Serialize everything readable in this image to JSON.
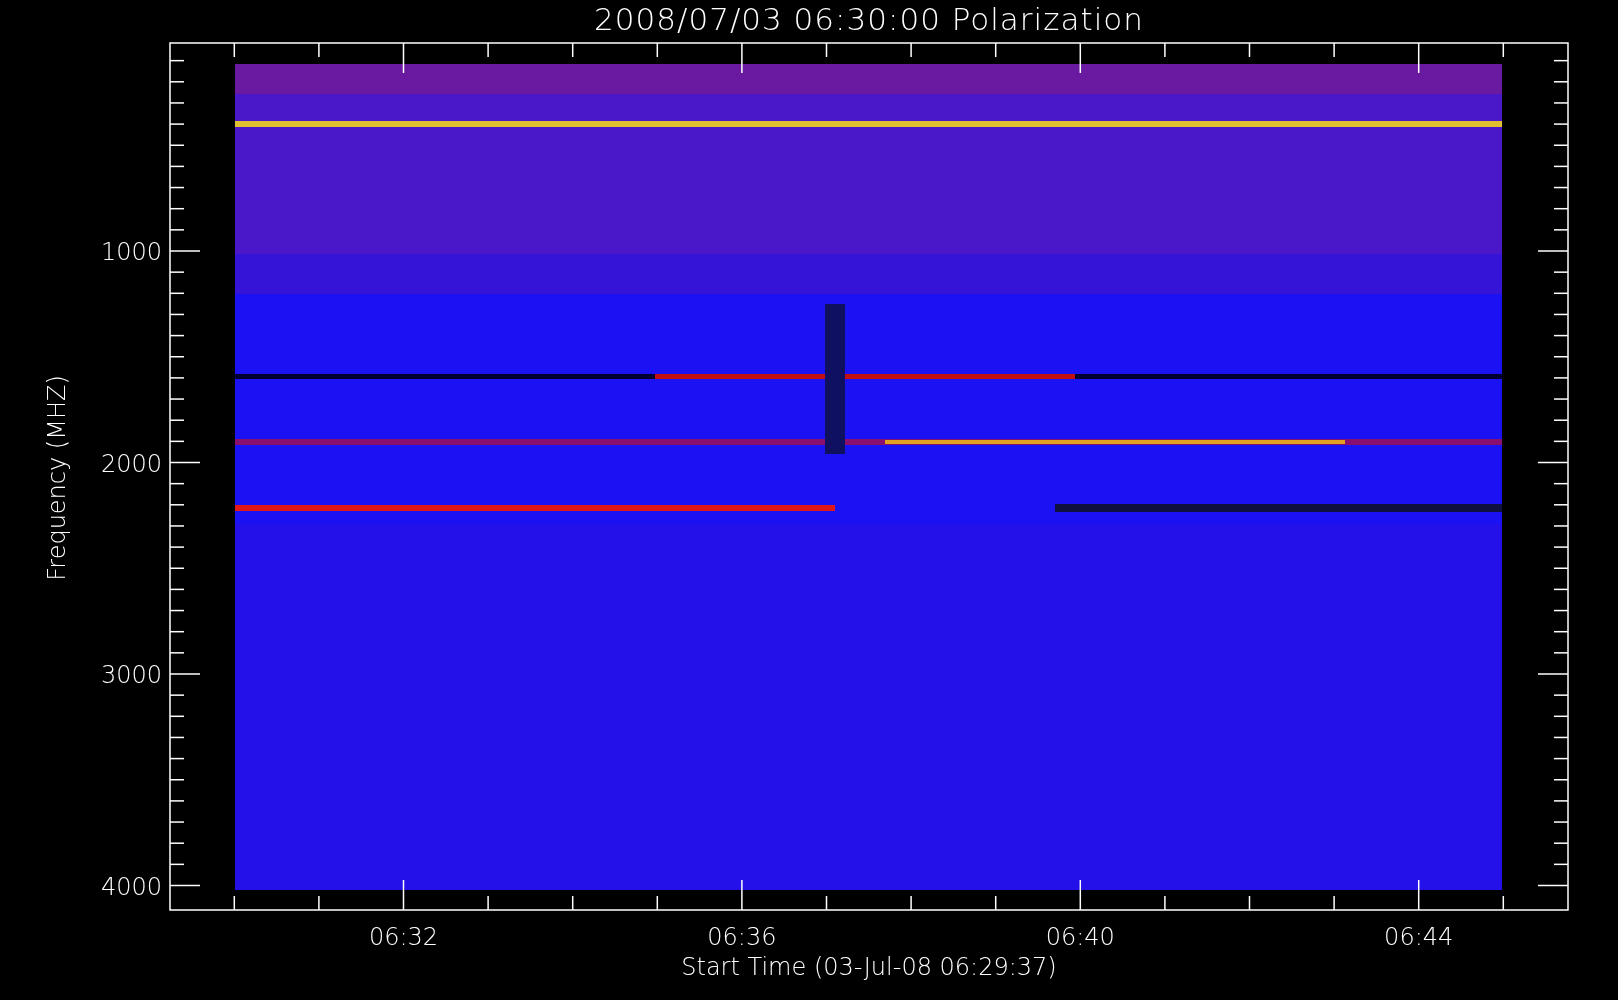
{
  "title": "2008/07/03 06:30:00 Polarization",
  "y_axis": {
    "label": "Frequency (MHZ)",
    "tick_labels": [
      "1000",
      "2000",
      "3000",
      "4000"
    ]
  },
  "x_axis": {
    "label": "Start Time (03-Jul-08 06:29:37)",
    "tick_labels": [
      "06:32",
      "06:36",
      "06:40",
      "06:44"
    ]
  }
}
